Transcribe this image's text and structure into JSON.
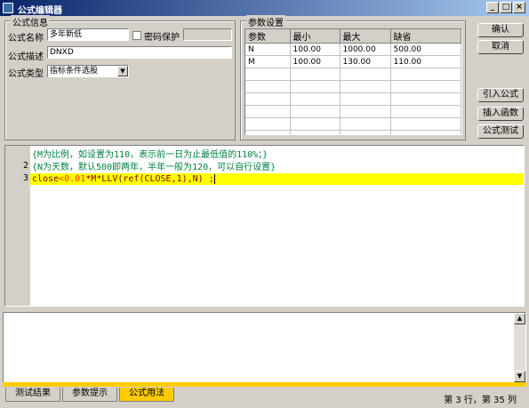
{
  "window": {
    "title": "公式编辑器",
    "minimize": "_",
    "maximize": "□",
    "close": "×"
  },
  "info": {
    "legend": "公式信息",
    "name_label": "公式名称",
    "name_value": "多年新低",
    "password_label": "密码保护",
    "desc_label": "公式描述",
    "desc_value": "DNXD",
    "type_label": "公式类型",
    "type_value": "指标条件选股"
  },
  "params": {
    "legend": "参数设置",
    "headers": [
      "参数",
      "最小",
      "最大",
      "缺省"
    ],
    "rows": [
      [
        "N",
        "100.00",
        "1000.00",
        "500.00"
      ],
      [
        "M",
        "100.00",
        "130.00",
        "110.00"
      ]
    ]
  },
  "buttons": {
    "ok": "确认",
    "cancel": "取消",
    "import": "引入公式",
    "insert_fn": "插入函数",
    "test": "公式测试"
  },
  "editor": {
    "line_numbers": [
      "2",
      "3"
    ],
    "line1": "{M为比例，如设置为110，表示前一日为止最低值的110%；}",
    "line2": "{N为天数，默认500即两年，半年一般为120，可以自行设置}",
    "line3_a": "close",
    "line3_op": "<",
    "line3_num": "0.01",
    "line3_b": "*M*LLV(ref(CLOSE,1),N) ;"
  },
  "tabs": [
    "测试结果",
    "参数提示",
    "公式用法"
  ],
  "status": "第 3 行，第 35 列",
  "scroll": {
    "up": "▲",
    "down": "▼"
  },
  "colors": {
    "title_start": "#0a246a",
    "title_end": "#a6caf0",
    "highlight": "#ffff00",
    "comment": "#007f3f",
    "active_tab": "#ffcc00"
  }
}
